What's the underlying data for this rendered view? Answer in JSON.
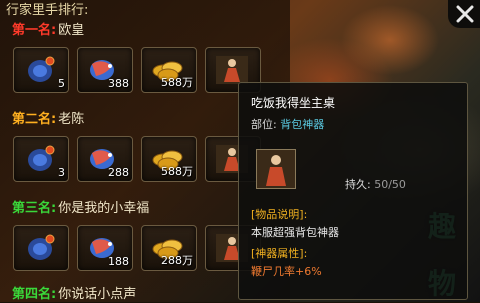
{
  "header": {
    "title": "行家里手排行:"
  },
  "ranks": [
    {
      "label": "第一名:",
      "name": "欧皇",
      "label_color": "#ff3a2a",
      "items": [
        {
          "icon": "rune-stone-icon",
          "count": "5"
        },
        {
          "icon": "spirit-fish-icon",
          "count": "388"
        },
        {
          "icon": "gold-coin-icon",
          "count": "588万"
        },
        {
          "icon": "artifact-figure-icon",
          "count": ""
        }
      ]
    },
    {
      "label": "第二名:",
      "name": "老陈",
      "label_color": "#ffb020",
      "items": [
        {
          "icon": "rune-stone-icon",
          "count": "3"
        },
        {
          "icon": "spirit-fish-icon",
          "count": "288"
        },
        {
          "icon": "gold-coin-icon",
          "count": "588万"
        },
        {
          "icon": "artifact-figure-icon",
          "count": ""
        }
      ]
    },
    {
      "label": "第三名:",
      "name": "你是我的小幸福",
      "label_color": "#3ad83a",
      "items": [
        {
          "icon": "rune-stone-icon",
          "count": ""
        },
        {
          "icon": "spirit-fish-icon",
          "count": "188"
        },
        {
          "icon": "gold-coin-icon",
          "count": "288万"
        },
        {
          "icon": "artifact-figure-icon",
          "count": ""
        }
      ]
    },
    {
      "label": "第四名:",
      "name": "你说话小点声",
      "label_color": "#3ad83a"
    }
  ],
  "tooltip": {
    "title": "吃饭我得坐主桌",
    "part_label": "部位:",
    "part_value": "背包神器",
    "durability_label": "持久:",
    "durability_value": "50/50",
    "desc_header": "[物品说明]:",
    "desc": "本服超强背包神器",
    "attr_header": "[神器属性]:",
    "attr": "鞭尸几率+6%"
  },
  "watermark": [
    "趣",
    "物"
  ],
  "colors": {
    "gold": "#f0b020",
    "cyan": "#5ac8e0",
    "orange": "#f07a30"
  }
}
